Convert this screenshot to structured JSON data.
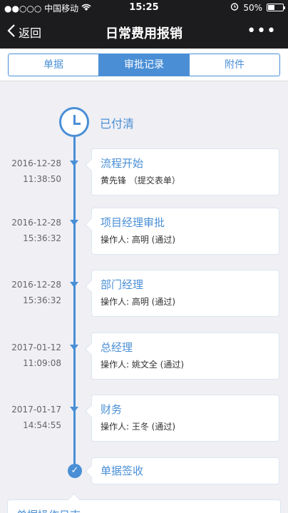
{
  "status_bar": {
    "carrier": "●●○○○ 中国移动",
    "wifi_icon": "wifi-icon",
    "time": "15:25",
    "alarm_icon": "alarm-icon",
    "battery_percent": "50%",
    "battery_level": 0.5
  },
  "nav": {
    "back_label": "返回",
    "title": "日常费用报销",
    "more_label": "•••"
  },
  "tabs": [
    {
      "label": "单据",
      "active": false
    },
    {
      "label": "审批记录",
      "active": true
    },
    {
      "label": "附件",
      "active": false
    }
  ],
  "timeline": {
    "status": "已付清",
    "nodes": [
      {
        "date": "2016-12-28",
        "time": "11:38:50",
        "title": "流程开始",
        "sub": "黄先锋 （提交表单）"
      },
      {
        "date": "2016-12-28",
        "time": "15:36:32",
        "title": "项目经理审批",
        "sub": "操作人:   高明 (通过)"
      },
      {
        "date": "2016-12-28",
        "time": "15:36:32",
        "title": "部门经理",
        "sub": "操作人:   高明 (通过)"
      },
      {
        "date": "2017-01-12",
        "time": "11:09:08",
        "title": "总经理",
        "sub": "操作人:   姚文全 (通过)"
      },
      {
        "date": "2017-01-17",
        "time": "14:54:55",
        "title": "财务",
        "sub": "操作人:   王冬 (通过)"
      }
    ],
    "end_label": "单据签收"
  },
  "log_panel": {
    "title": "单据操作日志"
  },
  "colors": {
    "accent": "#4a8fd6",
    "bar_bg": "#1c1c1e",
    "page_bg": "#efeff4"
  }
}
